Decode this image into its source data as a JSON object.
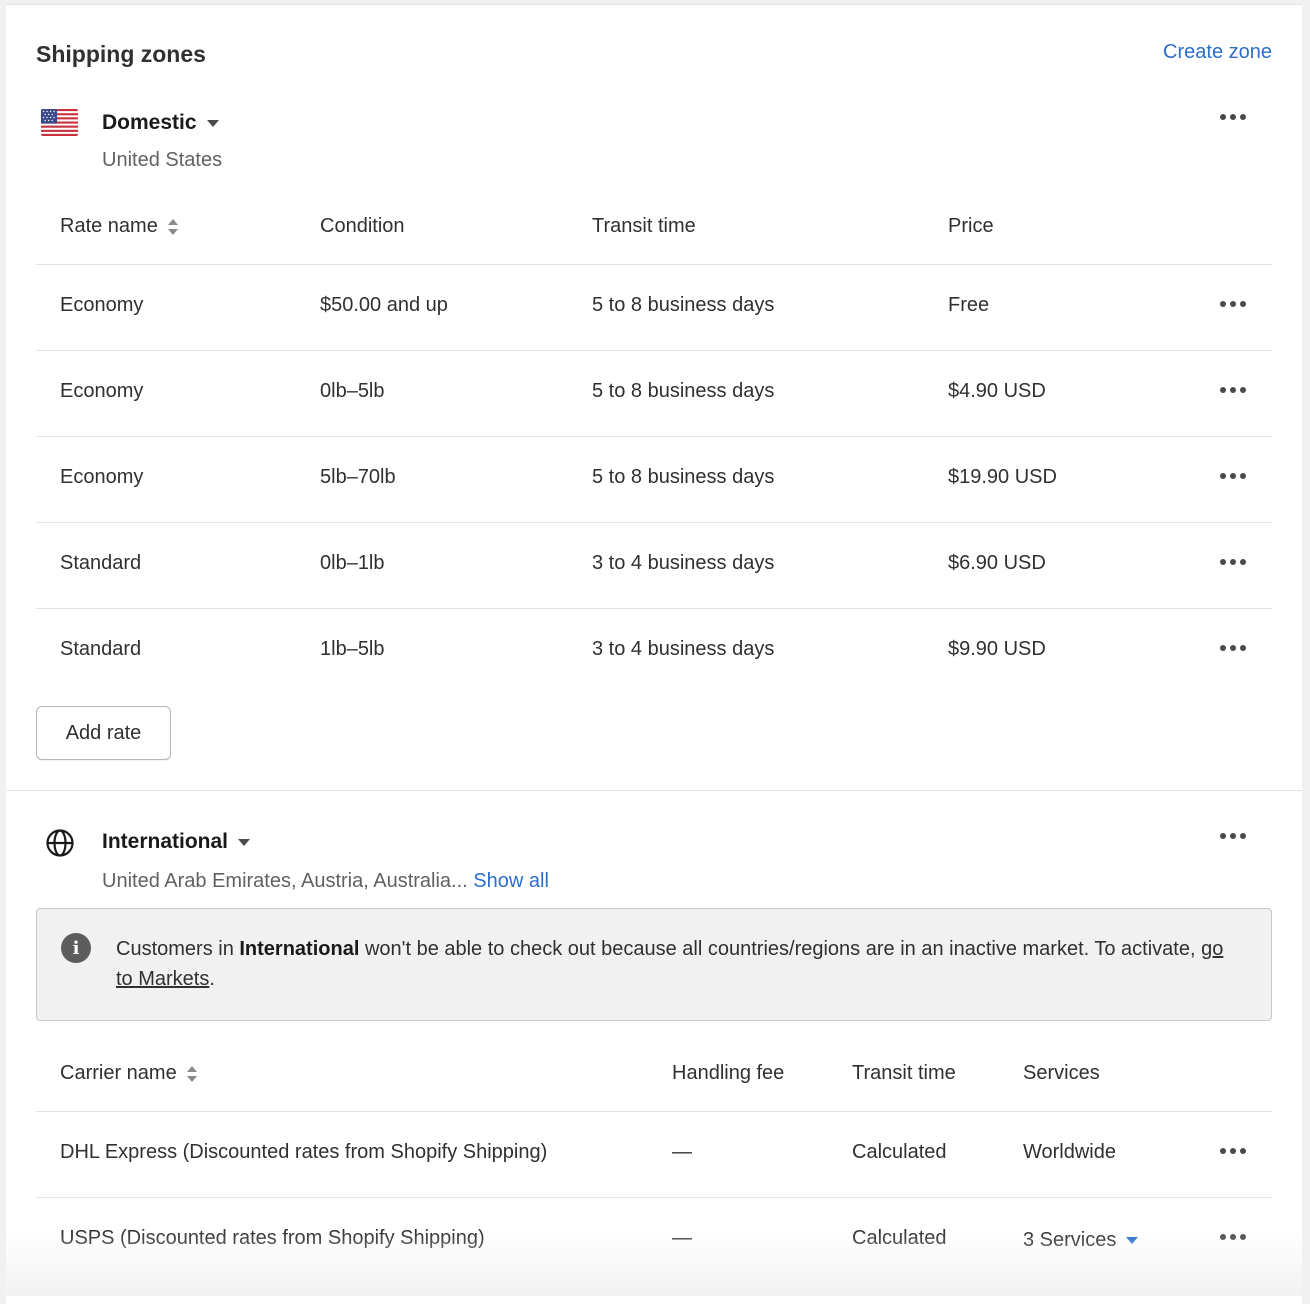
{
  "page": {
    "title": "Shipping zones",
    "create_zone": "Create zone"
  },
  "domestic": {
    "name": "Domestic",
    "countries": "United States",
    "columns": [
      "Rate name",
      "Condition",
      "Transit time",
      "Price"
    ],
    "rates": [
      {
        "name": "Economy",
        "condition": "$50.00 and up",
        "transit": "5 to 8 business days",
        "price": "Free"
      },
      {
        "name": "Economy",
        "condition": "0lb–5lb",
        "transit": "5 to 8 business days",
        "price": "$4.90 USD"
      },
      {
        "name": "Economy",
        "condition": "5lb–70lb",
        "transit": "5 to 8 business days",
        "price": "$19.90 USD"
      },
      {
        "name": "Standard",
        "condition": "0lb–1lb",
        "transit": "3 to 4 business days",
        "price": "$6.90 USD"
      },
      {
        "name": "Standard",
        "condition": "1lb–5lb",
        "transit": "3 to 4 business days",
        "price": "$9.90 USD"
      }
    ],
    "add_rate": "Add rate"
  },
  "international": {
    "name": "International",
    "countries": "United Arab Emirates, Austria, Australia...",
    "show_all": "Show all",
    "banner": {
      "prefix": "Customers in ",
      "bold": "International",
      "middle": " won't be able to check out because all countries/regions are in an inactive market. To activate, ",
      "link": "go to Markets",
      "suffix": "."
    },
    "columns": [
      "Carrier name",
      "Handling fee",
      "Transit time",
      "Services"
    ],
    "carriers": [
      {
        "name": "DHL Express (Discounted rates from Shopify Shipping)",
        "fee": "—",
        "transit": "Calculated",
        "services": "Worldwide"
      },
      {
        "name": "USPS (Discounted rates from Shopify Shipping)",
        "fee": "—",
        "transit": "Calculated",
        "services": "3 Services"
      }
    ]
  },
  "colors": {
    "link": "#2c6ecb",
    "text": "#303030",
    "muted": "#616161",
    "banner_bg": "#f1f1f2"
  }
}
